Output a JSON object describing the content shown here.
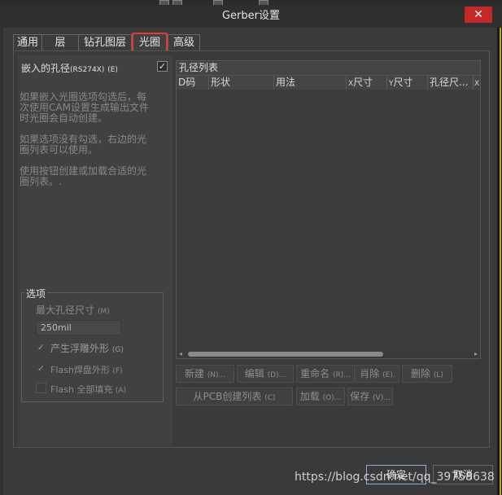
{
  "window": {
    "title": "Gerber设置",
    "close": "✕"
  },
  "tabs": [
    "通用",
    "层",
    "钻孔图层",
    "光圈",
    "高级"
  ],
  "left": {
    "embed_label": "嵌入的孔径",
    "embed_small": "(RS274X)",
    "embed_key": "(E)",
    "embed_checked": "✓",
    "desc1": [
      "如果嵌入光圈选项勾选后，每",
      "次使用CAM设置生成输出文件",
      "时光圈会自动创建。"
    ],
    "desc2": [
      "如果选项没有勾选，右边的光",
      "圈列表可以使用。"
    ],
    "desc3": [
      "使用按钮创建或加载合适的光",
      "圈列表。."
    ]
  },
  "options": {
    "title": "选项",
    "max_label": "最大孔径尺寸",
    "max_key": "(M)",
    "max_value": "250mil",
    "check1": {
      "mark": "✓",
      "label": "产生浮雕外形",
      "key": "(G)"
    },
    "check2": {
      "mark": "✓",
      "label": "Flash焊盘外形",
      "key": "(F)"
    },
    "check3": {
      "mark": "",
      "label": "Flash 全部填充",
      "key": "(A)"
    }
  },
  "table": {
    "title": "孔径列表",
    "columns": {
      "dcode": "D码",
      "shape": "形状",
      "usage": "用法",
      "xsize_pre": "X",
      "xsize": "尺寸",
      "ysize_pre": "Y",
      "ysize": "尺寸",
      "hole": "孔径尺...",
      "xtrunc": "X"
    }
  },
  "buttons": {
    "new": {
      "label": "新建",
      "key": "(N)..."
    },
    "edit": {
      "label": "编辑",
      "key": "(D)..."
    },
    "rename": {
      "label": "重命名",
      "key": "(R)..."
    },
    "delete1": {
      "label": "肖除",
      "key": "(E)."
    },
    "delete2": {
      "label": "删除",
      "key": "(L)"
    },
    "create_pcb": {
      "label": "从PCB创建列表",
      "key": "(C)"
    },
    "load": {
      "label": "加载",
      "key": "(O)..."
    },
    "save": {
      "label": "保存",
      "key": "(V)..."
    }
  },
  "footer": {
    "ok": "确定",
    "cancel": "取消"
  },
  "watermark": "https://blog.csdn.net/qq_39758638"
}
